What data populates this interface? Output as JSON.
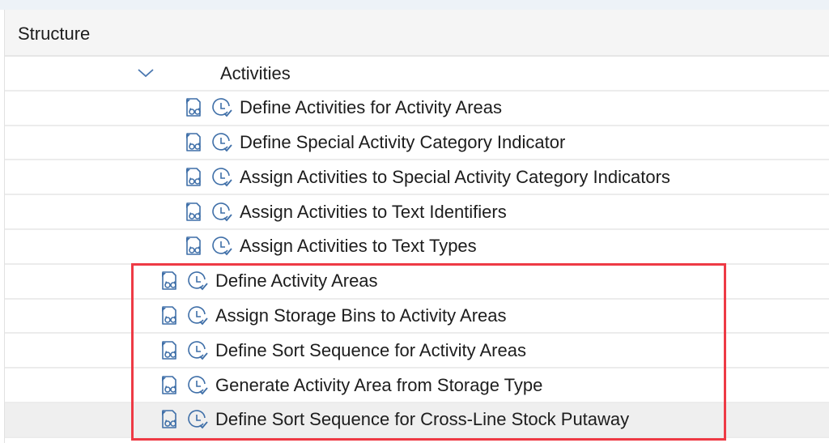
{
  "header": {
    "title": "Structure"
  },
  "tree": {
    "folder": {
      "label": "Activities",
      "expanded": true,
      "toggle_icon": "chevron-down-icon"
    },
    "items": [
      {
        "label": "Define Activities for Activity Areas",
        "level": 2,
        "icons": [
          "documentation-icon",
          "execute-activity-icon"
        ],
        "highlighted": false,
        "selected": false
      },
      {
        "label": "Define Special Activity Category Indicator",
        "level": 2,
        "icons": [
          "documentation-icon",
          "execute-activity-icon"
        ],
        "highlighted": false,
        "selected": false
      },
      {
        "label": "Assign Activities to Special Activity Category Indicators",
        "level": 2,
        "icons": [
          "documentation-icon",
          "execute-activity-icon"
        ],
        "highlighted": false,
        "selected": false
      },
      {
        "label": "Assign Activities to Text Identifiers",
        "level": 2,
        "icons": [
          "documentation-icon",
          "execute-activity-icon"
        ],
        "highlighted": false,
        "selected": false
      },
      {
        "label": "Assign Activities to Text Types",
        "level": 2,
        "icons": [
          "documentation-icon",
          "execute-activity-icon"
        ],
        "highlighted": false,
        "selected": false
      },
      {
        "label": "Define Activity Areas",
        "level": 1,
        "icons": [
          "documentation-icon",
          "execute-activity-icon"
        ],
        "highlighted": true,
        "selected": false
      },
      {
        "label": "Assign Storage Bins to Activity Areas",
        "level": 1,
        "icons": [
          "documentation-icon",
          "execute-activity-icon"
        ],
        "highlighted": true,
        "selected": false
      },
      {
        "label": "Define Sort Sequence for Activity Areas",
        "level": 1,
        "icons": [
          "documentation-icon",
          "execute-activity-icon"
        ],
        "highlighted": true,
        "selected": false
      },
      {
        "label": "Generate Activity Area from Storage Type",
        "level": 1,
        "icons": [
          "documentation-icon",
          "execute-activity-icon"
        ],
        "highlighted": true,
        "selected": false
      },
      {
        "label": "Define Sort Sequence for Cross-Line Stock Putaway",
        "level": 1,
        "icons": [
          "documentation-icon",
          "execute-activity-icon"
        ],
        "highlighted": true,
        "selected": true
      }
    ]
  },
  "colors": {
    "icon_blue": "#3f6fa8",
    "highlight_border": "#ee3a45",
    "selected_row": "#efefef",
    "header_bg": "#f5f5f5"
  }
}
